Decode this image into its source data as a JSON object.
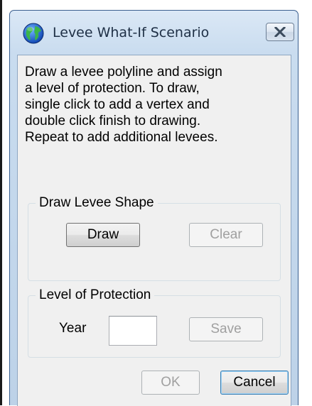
{
  "window": {
    "title": "Levee What-If Scenario",
    "app_icon": "globe-icon",
    "close_icon": "close-icon"
  },
  "instructions": "Draw a levee polyline and assign\na level of protection. To draw,\nsingle click to add a vertex and\ndouble click finish to drawing.\nRepeat to add additional levees.",
  "draw_group": {
    "legend": "Draw Levee Shape",
    "draw_button": "Draw",
    "clear_button": "Clear"
  },
  "protection_group": {
    "legend": "Level of Protection",
    "year_label": "Year",
    "year_value": "",
    "save_button": "Save"
  },
  "footer": {
    "ok_button": "OK",
    "cancel_button": "Cancel"
  },
  "colors": {
    "frame": "#c9dcef",
    "client": "#f0f0f0",
    "disabled_text": "#a0a0a0"
  }
}
